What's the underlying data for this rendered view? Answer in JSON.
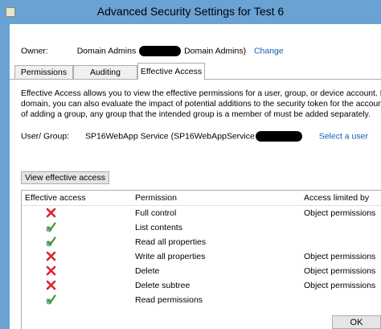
{
  "window": {
    "title": "Advanced Security Settings for Test 6"
  },
  "owner": {
    "label": "Owner:",
    "prefix": "Domain Admins",
    "suffix": "Domain Admins)",
    "change_link": "Change"
  },
  "tabs": [
    {
      "label": "Permissions",
      "active": false
    },
    {
      "label": "Auditing",
      "active": false
    },
    {
      "label": "Effective Access",
      "active": true
    }
  ],
  "description": {
    "line1": "Effective Access allows you to view the effective permissions for a user, group, or device account. If the acc",
    "line2": "domain, you can also evaluate the impact of potential additions to the security token for the account. Whe",
    "line3": "of adding a group, any group that the intended group is a member of must be added separately."
  },
  "principal": {
    "label": "User/ Group:",
    "value": "SP16WebApp Service (SP16WebAppService",
    "select_link": "Select a user"
  },
  "view_button": {
    "label": "View effective access"
  },
  "table": {
    "columns": [
      "Effective access",
      "Permission",
      "Access limited by"
    ],
    "rows": [
      {
        "status": "denied",
        "icon": "red-x-icon",
        "permission": "Full control",
        "limited_by": "Object permissions"
      },
      {
        "status": "allowed",
        "icon": "green-check-icon",
        "permission": "List contents",
        "limited_by": ""
      },
      {
        "status": "allowed",
        "icon": "green-check-icon",
        "permission": "Read all properties",
        "limited_by": ""
      },
      {
        "status": "denied",
        "icon": "red-x-icon",
        "permission": "Write all properties",
        "limited_by": "Object permissions"
      },
      {
        "status": "denied",
        "icon": "red-x-icon",
        "permission": "Delete",
        "limited_by": "Object permissions"
      },
      {
        "status": "denied",
        "icon": "red-x-icon",
        "permission": "Delete subtree",
        "limited_by": "Object permissions"
      },
      {
        "status": "allowed",
        "icon": "green-check-icon",
        "permission": "Read permissions",
        "limited_by": ""
      }
    ]
  },
  "ok_button": {
    "label": "OK"
  },
  "colors": {
    "titlebar": "#6aa2d4",
    "link": "#0a5db5",
    "deny": "#d9242a",
    "allow": "#3f9b2a"
  }
}
